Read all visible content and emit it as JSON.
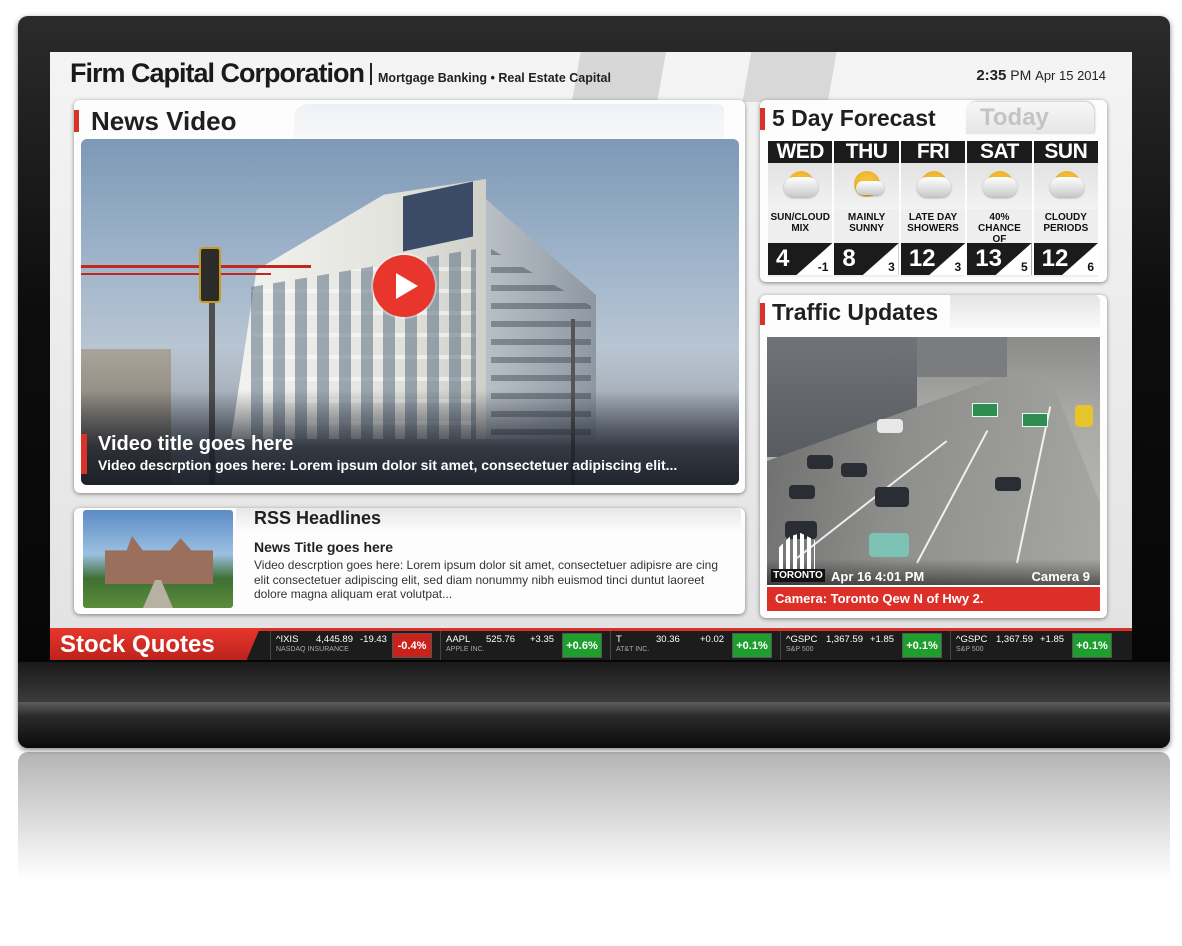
{
  "brand": {
    "name": "Firm Capital Corporation",
    "tagline": "Mortgage Banking • Real Estate Capital"
  },
  "clock": {
    "time": "2:35",
    "ampm": "PM",
    "date": "Apr 15 2014"
  },
  "news": {
    "title": "News Video",
    "video_title": "Video title goes here",
    "video_description": "Video descrption goes here: Lorem ipsum dolor sit amet, consectetuer adipiscing elit..."
  },
  "rss": {
    "title": "RSS Headlines",
    "news_title": "News Title goes here",
    "description": "Video descrption goes here: Lorem ipsum dolor sit amet, consectetuer adipisre are cing elit consectetuer adipiscing elit, sed diam nonummy nibh euismod tinci duntut laoreet dolore magna aliquam erat volutpat..."
  },
  "forecast": {
    "title": "5 Day Forecast",
    "tab_today": "Today",
    "days": [
      {
        "name": "WED",
        "condition_1": "SUN/CLOUD",
        "condition_2": "MIX",
        "hi": "4",
        "lo": "-1",
        "icon": "sun-cloud-icon"
      },
      {
        "name": "THU",
        "condition_1": "MAINLY",
        "condition_2": "SUNNY",
        "hi": "8",
        "lo": "3",
        "icon": "sunny-icon"
      },
      {
        "name": "FRI",
        "condition_1": "LATE DAY",
        "condition_2": "SHOWERS",
        "hi": "12",
        "lo": "3",
        "icon": "showers-icon"
      },
      {
        "name": "SAT",
        "condition_1": "40% CHANCE",
        "condition_2": "OF SHOWERS",
        "hi": "13",
        "lo": "5",
        "icon": "showers-icon"
      },
      {
        "name": "SUN",
        "condition_1": "CLOUDY",
        "condition_2": "PERIODS",
        "hi": "12",
        "lo": "6",
        "icon": "cloudy-icon"
      }
    ]
  },
  "traffic": {
    "title": "Traffic Updates",
    "logo_text": "TORONTO",
    "stamp": "Apr 16  4:01 PM",
    "camera_id": "Camera 9",
    "caption": "Camera: Toronto Qew N of Hwy 2."
  },
  "ticker": {
    "label": "Stock Quotes",
    "quotes": [
      {
        "symbol": "^IXIS",
        "name": "NASDAQ INSURANCE",
        "price": "4,445.89",
        "change": "-19.43",
        "pct": "-0.4%",
        "dir": "down"
      },
      {
        "symbol": "AAPL",
        "name": "APPLE INC.",
        "price": "525.76",
        "change": "+3.35",
        "pct": "+0.6%",
        "dir": "up"
      },
      {
        "symbol": "T",
        "name": "AT&T INC.",
        "price": "30.36",
        "change": "+0.02",
        "pct": "+0.1%",
        "dir": "up"
      },
      {
        "symbol": "^GSPC",
        "name": "S&P 500",
        "price": "1,367.59",
        "change": "+1.85",
        "pct": "+0.1%",
        "dir": "up"
      },
      {
        "symbol": "^GSPC",
        "name": "S&P 500",
        "price": "1,367.59",
        "change": "+1.85",
        "pct": "+0.1%",
        "dir": "up"
      }
    ]
  },
  "colors": {
    "accent": "#d9322b",
    "up": "#1e9e2c",
    "down": "#c7221b",
    "bezel": "#0d0d0d"
  }
}
